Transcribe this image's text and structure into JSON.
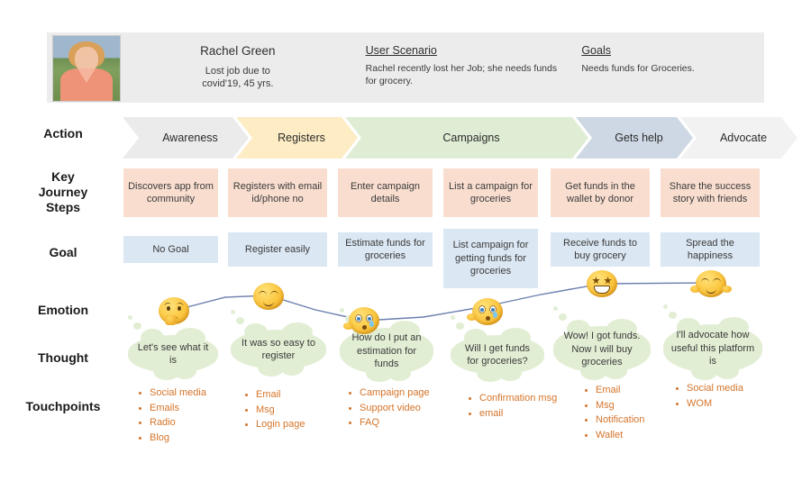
{
  "persona": {
    "avatar_icon": "user-photo",
    "name": "Rachel Green",
    "subtitle": "Lost job due to\ncovid'19, 45 yrs.",
    "scenario_heading": "User Scenario",
    "scenario_text": "Rachel recently lost her Job; she needs funds for grocery.",
    "goals_heading": "Goals",
    "goals_text": "Needs funds for Groceries."
  },
  "row_labels": {
    "action": "Action",
    "key_journey_steps": "Key\nJourney\nSteps",
    "goal": "Goal",
    "emotion": "Emotion",
    "thought": "Thought",
    "touchpoints": "Touchpoints"
  },
  "colors": {
    "header_bg": "#ececec",
    "chevron_grey": "#ebebeb",
    "chevron_yellow": "#fdecc4",
    "chevron_green": "#e0edd5",
    "chevron_blue": "#ced8e4",
    "chevron_light": "#f2f2f2",
    "step_peach": "#f9ded0",
    "goal_blue": "#dbe7f3",
    "cloud_green": "#e2eed4",
    "touchpoint_orange": "#d4742a",
    "emotion_line": "#6b7fae"
  },
  "stages": [
    {
      "action": "Awareness",
      "action_color": "#ebebeb",
      "step": "Discovers app from community",
      "goal": "No Goal",
      "emotion_icon": "thinking-face-emoji",
      "thought": "Let's see what it is",
      "touchpoints": [
        "Social media",
        "Emails",
        "Radio",
        "Blog"
      ]
    },
    {
      "action": "Registers",
      "action_color": "#fdecc4",
      "step": "Registers with email id/phone no",
      "goal": "Register easily",
      "emotion_icon": "relieved-face-emoji",
      "thought": "It was so easy to register",
      "touchpoints": [
        "Email",
        "Msg",
        "Login page"
      ]
    },
    {
      "action": "Campaigns",
      "action_color": "#e0edd5",
      "step": "Enter campaign details",
      "goal": "Estimate funds for groceries",
      "emotion_icon": "worried-face-emoji",
      "thought": "How do I put an estimation for funds",
      "touchpoints": [
        "Campaign page",
        "Support video",
        "FAQ"
      ]
    },
    {
      "action": "",
      "action_color": "#e0edd5",
      "step": "List a campaign for  groceries",
      "goal": "List campaign for getting funds for groceries",
      "emotion_icon": "anxious-face-emoji",
      "thought": "Will I get funds for groceries?",
      "touchpoints": [
        "Confirmation msg",
        "email"
      ]
    },
    {
      "action": "Gets help",
      "action_color": "#ced8e4",
      "step": "Get funds in the wallet by donor",
      "goal": "Receive funds to buy grocery",
      "emotion_icon": "star-struck-emoji",
      "thought": "Wow! I got funds. Now I will buy groceries",
      "touchpoints": [
        "Email",
        "Msg",
        "Notification",
        "Wallet"
      ]
    },
    {
      "action": "Advocate",
      "action_color": "#f2f2f2",
      "step": "Share the success story with friends",
      "goal": "Spread the happiness",
      "emotion_icon": "hugging-face-emoji",
      "thought": "I'll advocate how useful this platform is",
      "touchpoints": [
        "Social media",
        "WOM"
      ]
    }
  ]
}
